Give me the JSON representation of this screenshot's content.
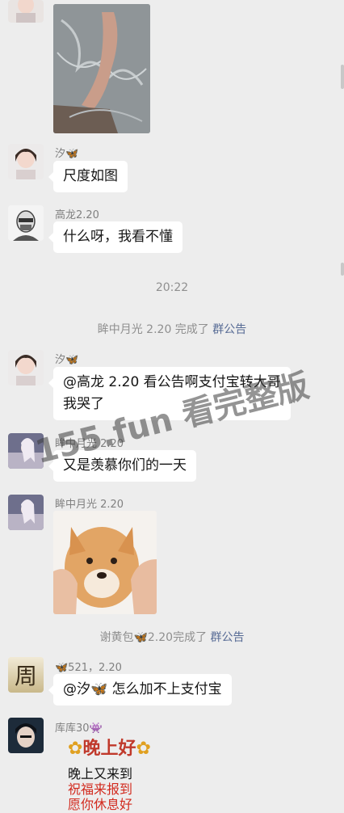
{
  "messages": {
    "m1": {
      "sender": "汐🦋",
      "text": "尺度如图"
    },
    "m2": {
      "sender": "高龙2.20",
      "text": "什么呀，我看不懂"
    },
    "time1": "20:22",
    "sys1": {
      "prefix": "眸中月光 2.20 完成了 ",
      "link": "群公告"
    },
    "m3": {
      "sender": "汐🦋",
      "text": "@高龙 2.20  看公告啊支付宝转大哥我哭了"
    },
    "m4": {
      "sender": "眸中月光 2.20",
      "text": "又是羡慕你们的一天"
    },
    "m5": {
      "sender": "眸中月光 2.20"
    },
    "sys2": {
      "prefix": "谢黄包🦋2.20完成了 ",
      "link": "群公告"
    },
    "m6": {
      "sender": "🦋521，2.20",
      "text": "@汐🦋  怎么加不上支付宝"
    },
    "m7": {
      "sender": "库库30👾",
      "title": "晚上好",
      "lines": [
        "晚上又来到",
        "祝福来报到",
        "愿你休息好"
      ]
    }
  },
  "watermark": "155.fun 看完整版",
  "colors": {
    "bg": "#ededed",
    "link": "#576b95",
    "bubble": "#ffffff"
  }
}
